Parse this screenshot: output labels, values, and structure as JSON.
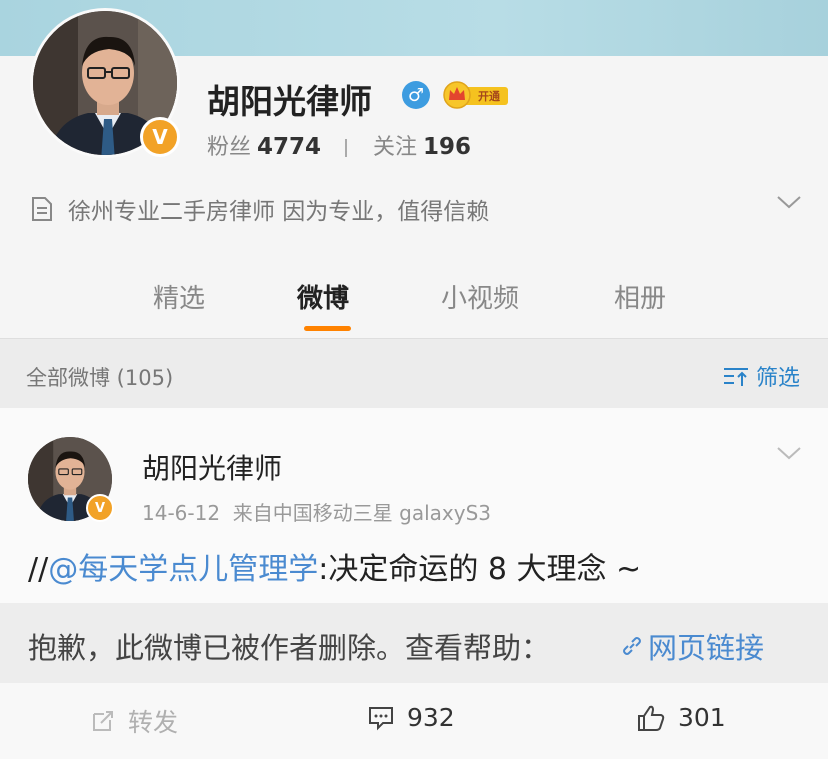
{
  "profile": {
    "name": "胡阳光律师",
    "gender_symbol": "♂",
    "vip_label": "开通",
    "verified_symbol": "V",
    "followers_label": "粉丝",
    "followers_count": "4774",
    "following_label": "关注",
    "following_count": "196",
    "bio": "徐州专业二手房律师 因为专业，值得信赖"
  },
  "tabs": [
    {
      "label": "精选",
      "active": false
    },
    {
      "label": "微博",
      "active": true
    },
    {
      "label": "小视频",
      "active": false
    },
    {
      "label": "相册",
      "active": false
    }
  ],
  "filter": {
    "label": "全部微博 (105)",
    "button_label": "筛选"
  },
  "post": {
    "author": "胡阳光律师",
    "date": "14-6-12",
    "source": "来自中国移动三星 galaxyS3",
    "text_prefix": "//",
    "mention": "@每天学点儿管理学",
    "text_rest": ":决定命运的 8 大理念 ~",
    "deleted_message": "抱歉，此微博已被作者删除。查看帮助：",
    "help_link": "网页链接",
    "actions": {
      "repost_label": "转发",
      "comment_count": "932",
      "like_count": "301"
    }
  },
  "colors": {
    "accent": "#ff8200",
    "link": "#4a8ad0",
    "verified": "#f2a227",
    "gender": "#3d9ce0"
  }
}
